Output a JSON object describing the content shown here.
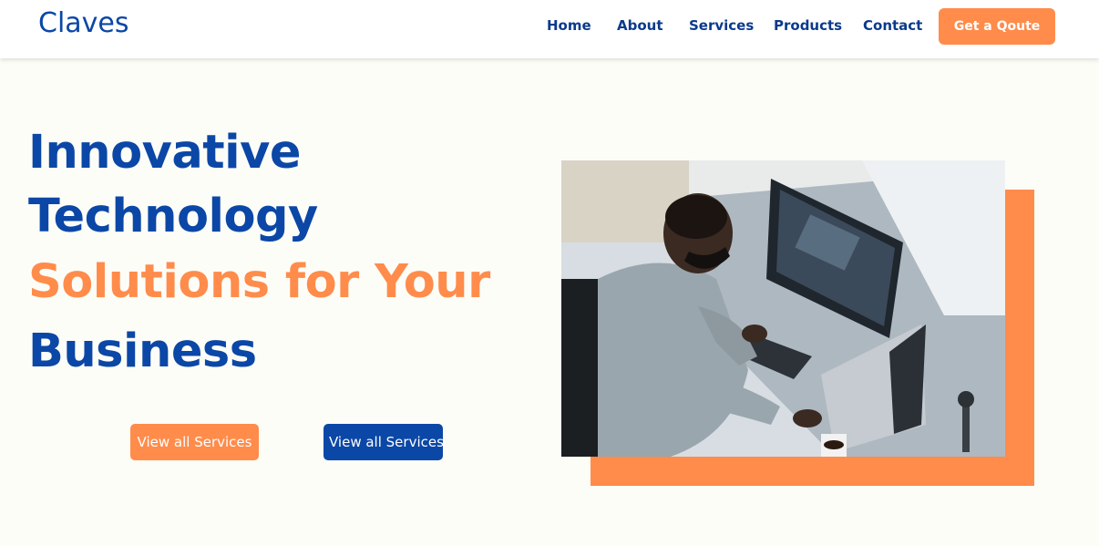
{
  "header": {
    "logo": "Claves",
    "nav": {
      "home": "Home",
      "about": "About",
      "services": "Services",
      "products": "Products",
      "contact": "Contact"
    },
    "cta": "Get a Qoute"
  },
  "hero": {
    "line1": "Innovative",
    "line2": "Technology",
    "line3": "Solutions for Your",
    "line4": "Business",
    "button_primary": "View all Services",
    "button_secondary": "View all Services",
    "image_description_icon": "photo-person-at-computer"
  },
  "colors": {
    "brand_blue": "#0b47a6",
    "accent_orange": "#ff8c4b",
    "background": "#fdfdf8"
  }
}
